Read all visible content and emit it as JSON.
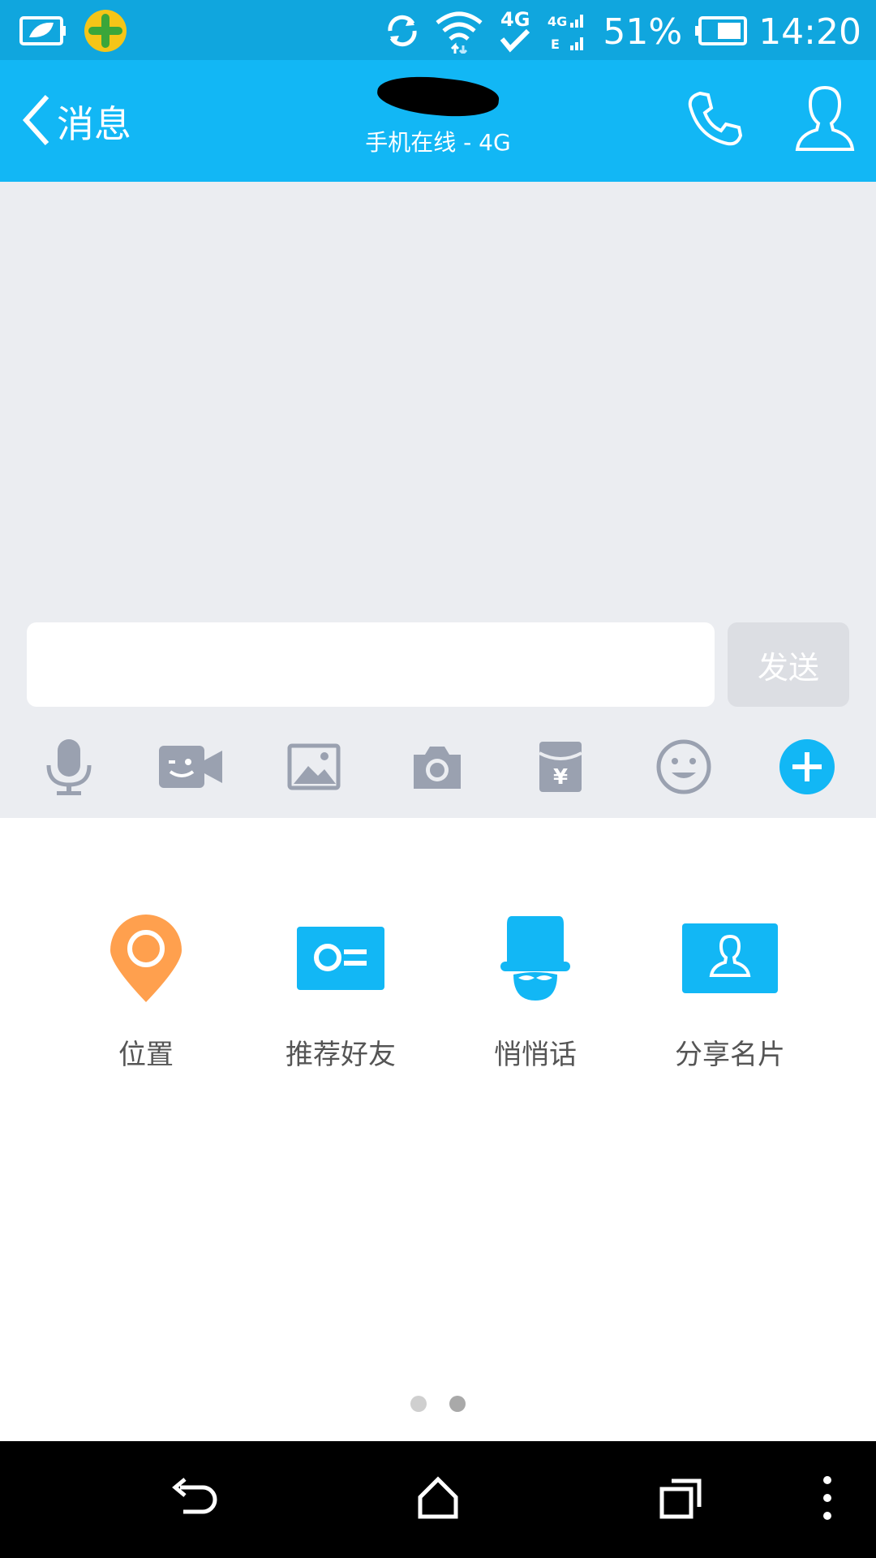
{
  "status_bar": {
    "battery_percent": "51%",
    "time": "14:20",
    "network": "4G"
  },
  "header": {
    "back_label": "消息",
    "subtitle": "手机在线 - 4G"
  },
  "composer": {
    "input_value": "",
    "send_label": "发送"
  },
  "toolbar_icons": [
    "microphone-icon",
    "video-call-icon",
    "image-icon",
    "camera-icon",
    "red-packet-icon",
    "emoji-icon",
    "plus-icon"
  ],
  "panel": {
    "items": [
      {
        "label": "位置",
        "icon": "location-pin-icon",
        "color": "#ffa04e"
      },
      {
        "label": "推荐好友",
        "icon": "contact-card-icon",
        "color": "#12b7f5"
      },
      {
        "label": "悄悄话",
        "icon": "whisper-hat-icon",
        "color": "#12b7f5"
      },
      {
        "label": "分享名片",
        "icon": "share-card-icon",
        "color": "#12b7f5"
      }
    ],
    "page_index": 2,
    "page_count": 2
  },
  "colors": {
    "header": "#12b7f5",
    "status_bar": "#10a6de",
    "accent": "#12b7f5",
    "background": "#ebedf1"
  }
}
